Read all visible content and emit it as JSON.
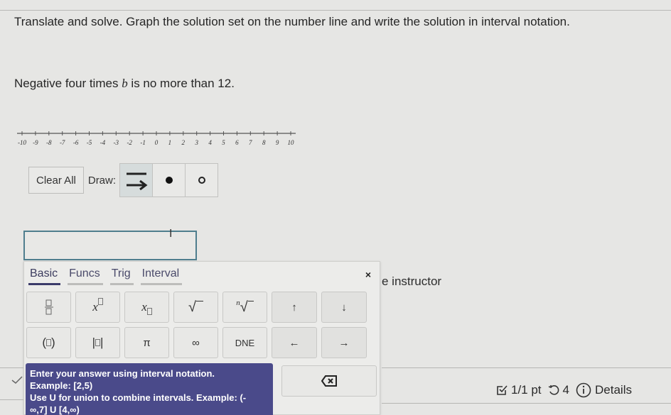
{
  "question": {
    "instruction": "Translate and solve. Graph the solution set on the number line and write the solution in interval notation.",
    "problem_prefix": "Negative four times ",
    "problem_variable": "b",
    "problem_suffix": " is no more than 12."
  },
  "number_line": {
    "min": -10,
    "max": 10,
    "tick_labels": [
      "-10",
      "-9",
      "-8",
      "-7",
      "-6",
      "-5",
      "-4",
      "-3",
      "-2",
      "-1",
      "0",
      "1",
      "2",
      "3",
      "4",
      "5",
      "6",
      "7",
      "8",
      "9",
      "10"
    ]
  },
  "draw_controls": {
    "clear_label": "Clear All",
    "draw_label": "Draw:",
    "tools": [
      {
        "name": "ray-tool",
        "icon": "ray-arrow-icon",
        "active": true
      },
      {
        "name": "closed-dot-tool",
        "icon": "filled-dot-icon",
        "active": false
      },
      {
        "name": "open-dot-tool",
        "icon": "open-dot-icon",
        "active": false
      }
    ]
  },
  "answer": {
    "value": "",
    "placeholder": ""
  },
  "keypad": {
    "tabs": [
      {
        "label": "Basic",
        "active": true
      },
      {
        "label": "Funcs",
        "active": false
      },
      {
        "label": "Trig",
        "active": false
      },
      {
        "label": "Interval",
        "active": false
      }
    ],
    "close_label": "×",
    "row1": [
      "fraction",
      "x^□",
      "x_□",
      "√",
      "ⁿ√",
      "↑",
      "↓"
    ],
    "row2": [
      "(□)",
      "|□|",
      "π",
      "∞",
      "DNE",
      "←",
      "→"
    ],
    "labels": {
      "pi": "π",
      "infinity": "∞",
      "dne": "DNE",
      "up": "↑",
      "down": "↓",
      "left": "←",
      "right": "→",
      "sqrt": "√",
      "nroot_index": "n"
    }
  },
  "tooltip": {
    "line1": "Enter your answer using interval notation.",
    "line2": "Example: [2,5)",
    "line3": "Use U for union to combine intervals. Example: (-",
    "line4": "∞,7] U [4,∞)"
  },
  "behind_text": "e instructor",
  "status": {
    "score": "1/1 pt",
    "retries": "4",
    "details_label": "Details"
  },
  "colors": {
    "tooltip_bg": "#4a4a8a",
    "input_border": "#4f7e8e",
    "active_tab": "#3b3b6a"
  }
}
